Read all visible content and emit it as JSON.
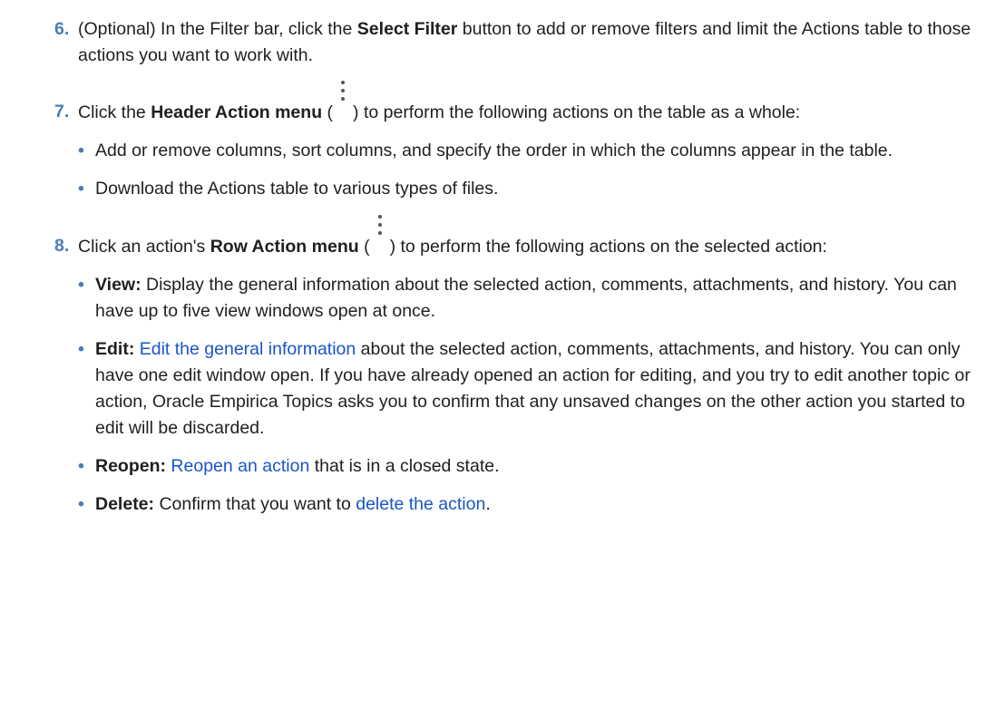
{
  "step6": {
    "num": "6.",
    "t1": "(Optional) In the Filter bar, click the ",
    "b1": "Select Filter",
    "t2": " button to add or remove filters and limit the Actions table to those actions you want to work with."
  },
  "step7": {
    "num": "7.",
    "t1": "Click the ",
    "b1": "Header Action menu",
    "t2": " (",
    "t3": ") to perform the following actions on the table as a whole:",
    "bullets": [
      "Add or remove columns, sort columns, and specify the order in which the columns appear in the table.",
      "Download the Actions table to various types of files."
    ]
  },
  "step8": {
    "num": "8.",
    "t1": "Click an action's ",
    "b1": "Row Action menu",
    "t2": " (",
    "t3": ") to perform the following actions on the selected action:",
    "view": {
      "label": "View:",
      "text": " Display the general information about the selected action, comments, attachments, and history. You can have up to five view windows open at once."
    },
    "edit": {
      "label": "Edit:",
      "link": "Edit the general information",
      "text": " about the selected action, comments, attachments, and history. You can only have one edit window open. If you have already opened an action for editing, and you try to edit another topic or action, Oracle Empirica Topics asks you to confirm that any unsaved changes on the other action you started to edit will be discarded."
    },
    "reopen": {
      "label": "Reopen:",
      "link": "Reopen an action",
      "text": " that is in a closed state."
    },
    "delete": {
      "label": "Delete:",
      "pre": " Confirm that you want to ",
      "link": "delete the action",
      "post": "."
    }
  },
  "bullet_char": "•",
  "colors": {
    "accent": "#4a7cb8",
    "link": "#1a55c7",
    "text": "#1f1f1f"
  },
  "icons": {
    "menu": "vertical-ellipsis-icon"
  }
}
